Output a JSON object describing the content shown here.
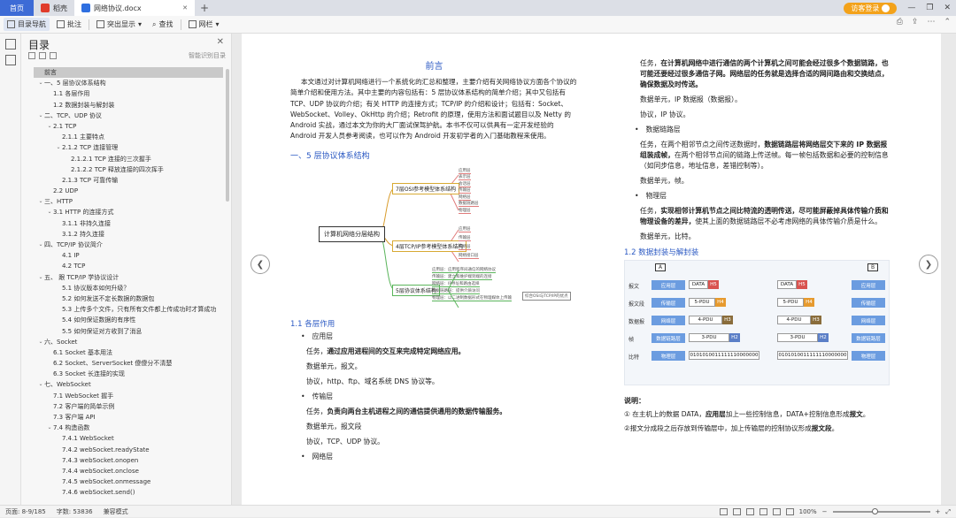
{
  "tabs": {
    "home": "首页",
    "wps": "稻壳",
    "doc": "网络协议.docx",
    "close": "✕",
    "add": "+"
  },
  "window": {
    "login": "访客登录",
    "min": "—",
    "max": "❐",
    "close": "✕"
  },
  "toolbar": {
    "toc_nav": "目录导航",
    "comment": "批注",
    "highlight": "突出显示",
    "find": "查找",
    "bookmark": "网栏"
  },
  "sidebar": {
    "title": "目录",
    "smart": "智能识别目录"
  },
  "toc": [
    {
      "label": "前言",
      "indent": 0,
      "chev": "",
      "sel": true
    },
    {
      "label": "一、5 层协议体系结构",
      "indent": 0,
      "chev": "⌄"
    },
    {
      "label": "1.1 各层作用",
      "indent": 1,
      "chev": ""
    },
    {
      "label": "1.2 数据封装与解封装",
      "indent": 1,
      "chev": ""
    },
    {
      "label": "二、TCP、UDP 协议",
      "indent": 0,
      "chev": "⌄"
    },
    {
      "label": "2.1 TCP",
      "indent": 1,
      "chev": "⌄"
    },
    {
      "label": "2.1.1 主要特点",
      "indent": 2,
      "chev": ""
    },
    {
      "label": "2.1.2 TCP 连接管理",
      "indent": 2,
      "chev": "⌄"
    },
    {
      "label": "2.1.2.1 TCP 连接的三次握手",
      "indent": 3,
      "chev": ""
    },
    {
      "label": "2.1.2.2 TCP 释放连接的四次挥手",
      "indent": 3,
      "chev": ""
    },
    {
      "label": "2.1.3 TCP 可靠传输",
      "indent": 2,
      "chev": ""
    },
    {
      "label": "2.2 UDP",
      "indent": 1,
      "chev": ""
    },
    {
      "label": "三、HTTP",
      "indent": 0,
      "chev": "⌄"
    },
    {
      "label": "3.1 HTTP 的连接方式",
      "indent": 1,
      "chev": "⌄"
    },
    {
      "label": "3.1.1 非持久连接",
      "indent": 2,
      "chev": ""
    },
    {
      "label": "3.1.2 持久连接",
      "indent": 2,
      "chev": ""
    },
    {
      "label": "四、TCP/IP 协议简介",
      "indent": 0,
      "chev": "⌄"
    },
    {
      "label": "4.1 IP",
      "indent": 2,
      "chev": ""
    },
    {
      "label": "4.2 TCP",
      "indent": 2,
      "chev": ""
    },
    {
      "label": "五、 跟 TCP/IP 学协议设计",
      "indent": 0,
      "chev": "⌄"
    },
    {
      "label": "5.1 协议版本如何升级？",
      "indent": 2,
      "chev": ""
    },
    {
      "label": "5.2 如何发送不定长数据的数据包",
      "indent": 2,
      "chev": ""
    },
    {
      "label": "5.3 上传多个文件，只有所有文件都上传成功时才算成功",
      "indent": 2,
      "chev": ""
    },
    {
      "label": "5.4 如何保证数据的有序性",
      "indent": 2,
      "chev": ""
    },
    {
      "label": "5.5 如何保证对方收到了消息",
      "indent": 2,
      "chev": ""
    },
    {
      "label": "六、Socket",
      "indent": 0,
      "chev": "⌄"
    },
    {
      "label": "6.1 Socket 基本用法",
      "indent": 1,
      "chev": ""
    },
    {
      "label": "6.2 Socket、ServerSocket 傻傻分不清楚",
      "indent": 1,
      "chev": ""
    },
    {
      "label": "6.3 Socket 长连接的实现",
      "indent": 1,
      "chev": ""
    },
    {
      "label": "七、WebSocket",
      "indent": 0,
      "chev": "⌄"
    },
    {
      "label": "7.1 WebSocket 握手",
      "indent": 1,
      "chev": ""
    },
    {
      "label": "7.2 客户端的简单示例",
      "indent": 1,
      "chev": ""
    },
    {
      "label": "7.3 客户端 API",
      "indent": 1,
      "chev": ""
    },
    {
      "label": "7.4 构造函数",
      "indent": 1,
      "chev": "⌄"
    },
    {
      "label": "7.4.1 WebSocket",
      "indent": 2,
      "chev": ""
    },
    {
      "label": "7.4.2 webSocket.readyState",
      "indent": 2,
      "chev": ""
    },
    {
      "label": "7.4.3 webSocket.onopen",
      "indent": 2,
      "chev": ""
    },
    {
      "label": "7.4.4 webSocket.onclose",
      "indent": 2,
      "chev": ""
    },
    {
      "label": "7.4.5 webSocket.onmessage",
      "indent": 2,
      "chev": ""
    },
    {
      "label": "7.4.6 webSocket.send()",
      "indent": 2,
      "chev": ""
    }
  ],
  "doc": {
    "preface_title": "前言",
    "preface": "本文通过对计算机网络进行一个系统化的汇总和整理，主要介绍有关网络协议方面各个协议的简单介绍和使用方法。其中主要的内容包括有：5 层协议体系结构的简单介绍；其中又包括有 TCP、UDP 协议的介绍；有关 HTTP 的连接方式；TCP/IP 的介绍和设计；包括有：Socket、WebSocket、Volley、OkHttp 的介绍；Retrofit 的原理，使用方法和面试题目以及 Netty 的 Android 实战，通过本文为你的大厂面试保驾护航。本书不仅可以供具有一定开发经验的 Android 开发人员参考阅读，也可以作为 Android 开发初学者的入门基础教程来使用。",
    "sec1": "一、5 层协议体系结构",
    "mind": {
      "root": "计算机网络分层结构",
      "n1": "7层OSI参考模型体系结构",
      "n2": "4层TCP/IP参考模型体系结构",
      "n3": "5层协议体系结构",
      "leaves1": [
        "应用层",
        "表示层",
        "会话层",
        "传输层",
        "网络层",
        "数据链路层",
        "物理层"
      ],
      "leaves2": [
        "应用层",
        "传输层",
        "网络层",
        "网络接口层"
      ],
      "leaves3": [
        "应用层：应用程序间通信的网络协议",
        "传输层：建立和维护端到端的连接",
        "网络层：IP寻址和路由选择",
        "数据链路层：提供介质访问",
        "物理层：以二进制数据形式在物理媒体上传输"
      ],
      "right3": "综合OSI与TCP/IP的优点"
    },
    "sec11": "1.1 各层作用",
    "app_layer": "应用层",
    "app_task_pre": "任务，",
    "app_task": "通过应用进程间的交互来完成特定网络应用。",
    "app_unit": "数据单元，报文。",
    "app_proto": "协议，http、ftp、域名系统 DNS 协议等。",
    "trans_layer": "传输层",
    "trans_task_pre": "任务，",
    "trans_task": "负责向两台主机进程之间的通信提供通用的数据传输服务。",
    "trans_unit": "数据单元，报文段",
    "trans_proto": "协议，TCP、UDP 协议。",
    "net_layer": "网络层",
    "r_task_pre": "任务，",
    "r_task": "在计算机网络中进行通信的两个计算机之间可能会经过很多个数据链路，也可能还要经过很多通信子网。网络层的任务就是选择合适的网间路由和交换结点， 确保数据及时传送。",
    "r_unit": "数据单元，IP 数据报（数据报）。",
    "r_proto": "协议，IP 协议。",
    "dl_layer": "数据链路层",
    "dl_task_pre": "任务，在两个相邻节点之间传送数据时，",
    "dl_task_b": "数据链路层将网络层交下来的 IP 数据报组装成帧，",
    "dl_task_post": "在两个相邻节点间的链路上传送帧。每一帧包括数据和必要的控制信息（如同步信息，地址信息，差错控制等）。",
    "dl_unit": "数据单元，帧。",
    "ph_layer": "物理层",
    "ph_task_pre": "任务，",
    "ph_task_b": "实现相邻计算机节点之间比特流的透明传送，尽可能屏蔽掉具体传输介质和物理设备的差异，",
    "ph_task_post": "使其上面的数据链路层不必考虑网络的具体传输介质是什么。",
    "ph_unit": "数据单元，比特。",
    "sec12": "1.2 数据封装与解封装",
    "encap": {
      "host_a": "A",
      "host_b": "B",
      "rows": [
        "报文",
        "报文段",
        "数据报",
        "帧",
        "比特"
      ],
      "layers": [
        "应用层",
        "传输层",
        "网络层",
        "数据链路层",
        "物理层"
      ],
      "data": "DATA",
      "h5": "H5",
      "pdu5": "5-PDU",
      "h4": "H4",
      "pdu4": "4-PDU",
      "h3": "H3",
      "pdu3": "3-PDU",
      "h2": "H2",
      "bits": "0101010011111110000000"
    },
    "note_title": "说明：",
    "note1_pre": "① 在主机上的数据 DATA，",
    "note1_b": "应用层",
    "note1_mid": "加上一些控制信息，DATA+控制信息形成",
    "note1_b2": "报文",
    "note1_end": "。",
    "note2_pre": "②报文分成段之后存放到传输层中，加上传输层的控制协议形成",
    "note2_b": "报文段",
    "note2_end": "。"
  },
  "status": {
    "page": "页面: 8-9/185",
    "words": "字数: 53836",
    "mode": "兼容模式",
    "zoom": "100%",
    "minus": "−",
    "plus": "+"
  }
}
